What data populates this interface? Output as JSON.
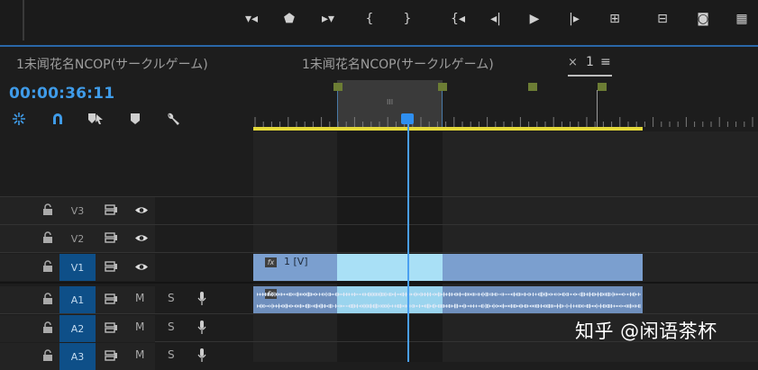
{
  "transport": {
    "buttons": [
      {
        "name": "mark-in-icon",
        "glyph": "▾◂"
      },
      {
        "name": "marker-icon",
        "glyph": "⬟"
      },
      {
        "name": "mark-out-icon",
        "glyph": "▸▾"
      },
      {
        "name": "go-to-in-icon",
        "glyph": "{"
      },
      {
        "name": "go-to-out-icon",
        "glyph": "}"
      },
      {
        "name": "step-to-in-icon",
        "glyph": "{◂"
      },
      {
        "name": "step-back-icon",
        "glyph": "◂|"
      },
      {
        "name": "play-icon",
        "glyph": "▶"
      },
      {
        "name": "step-forward-icon",
        "glyph": "|▸"
      },
      {
        "name": "lift-icon",
        "glyph": "⊞"
      },
      {
        "name": "extract-icon",
        "glyph": "⊟"
      },
      {
        "name": "camera-icon",
        "glyph": "◙"
      },
      {
        "name": "comparison-icon",
        "glyph": "▦"
      }
    ]
  },
  "tabs": {
    "source_title": "1未闻花名NCOP(サークルゲーム)",
    "sequence_title": "1未闻花名NCOP(サークルゲーム)",
    "active_tab_close": "×",
    "active_tab_label": "1",
    "active_tab_menu": "≡"
  },
  "timeline": {
    "timecode": "00:00:36:11",
    "tools": [
      "snap-icon",
      "linked-selection-icon",
      "add-marker-tool-icon",
      "marker-icon",
      "wrench-icon"
    ],
    "in_out_label": "III"
  },
  "tracks": [
    {
      "name": "V3",
      "type": "video",
      "active": false
    },
    {
      "name": "V2",
      "type": "video",
      "active": false
    },
    {
      "name": "V1",
      "type": "video",
      "active": true
    },
    {
      "name": "A1",
      "type": "audio",
      "active": true
    },
    {
      "name": "A2",
      "type": "audio",
      "active": true
    },
    {
      "name": "A3",
      "type": "audio",
      "active": true
    }
  ],
  "track_buttons": {
    "mute": "M",
    "solo": "S"
  },
  "clips": {
    "v1_fx": "fx",
    "v1_label": "1 [V]",
    "a1_fx": "fx"
  },
  "watermark": "知乎 @闲语茶杯",
  "colors": {
    "timecode": "#3f9be8",
    "playhead": "#2f8ff0",
    "work_area": "#e4d93a",
    "video_clip": "#7b9fcf",
    "selected_range": "#a9e0f6",
    "marker": "#6c7d34",
    "active_track": "#0e4f88"
  }
}
